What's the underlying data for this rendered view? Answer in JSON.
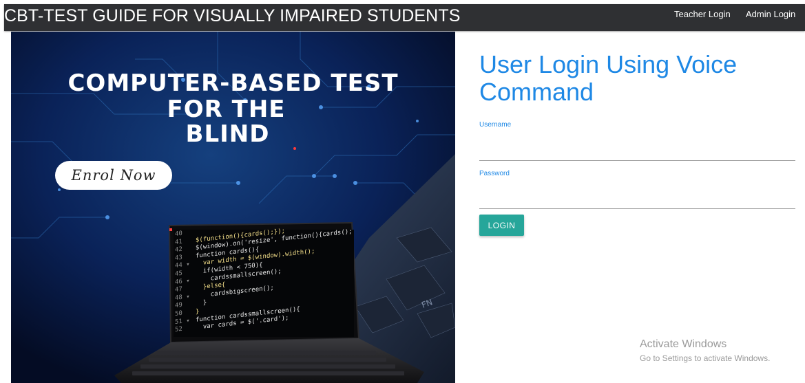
{
  "navbar": {
    "brand": "CBT-TEST GUIDE FOR VISUALLY IMPAIRED STUDENTS",
    "links": [
      {
        "label": "Teacher Login"
      },
      {
        "label": "Admin Login"
      }
    ]
  },
  "hero": {
    "title_lines": [
      "COMPUTER-BASED TEST",
      "FOR THE",
      "BLIND"
    ],
    "cta_label": "Enrol Now",
    "code_lines": [
      {
        "num": "40",
        "code": ""
      },
      {
        "num": "41",
        "code": "$(function(){cards();});"
      },
      {
        "num": "42",
        "code": "$(window).on('resize', function(){cards();});"
      },
      {
        "num": "43",
        "code": "function cards(){"
      },
      {
        "num": "44 ▾",
        "code": "  var width = $(window).width();"
      },
      {
        "num": "45",
        "code": "  if(width < 750){"
      },
      {
        "num": "46 ▾",
        "code": "    cardssmallscreen();"
      },
      {
        "num": "47",
        "code": "  }else{"
      },
      {
        "num": "48 ▾",
        "code": "    cardsbigscreen();"
      },
      {
        "num": "49",
        "code": "  }"
      },
      {
        "num": "50",
        "code": "}"
      },
      {
        "num": "51 ▾",
        "code": "function cardssmallscreen(){"
      },
      {
        "num": "52",
        "code": "  var cards = $('.card');"
      }
    ]
  },
  "login": {
    "title": "User Login Using Voice Command",
    "username_label": "Username",
    "username_value": "",
    "password_label": "Password",
    "password_value": "",
    "button_label": "LOGIN"
  },
  "watermark": {
    "title": "Activate Windows",
    "subtitle": "Go to Settings to activate Windows."
  },
  "colors": {
    "navbar": "#2f3033",
    "accent_blue": "#1e88e5",
    "button_teal": "#26a69a",
    "hero_bg": "#071533"
  }
}
